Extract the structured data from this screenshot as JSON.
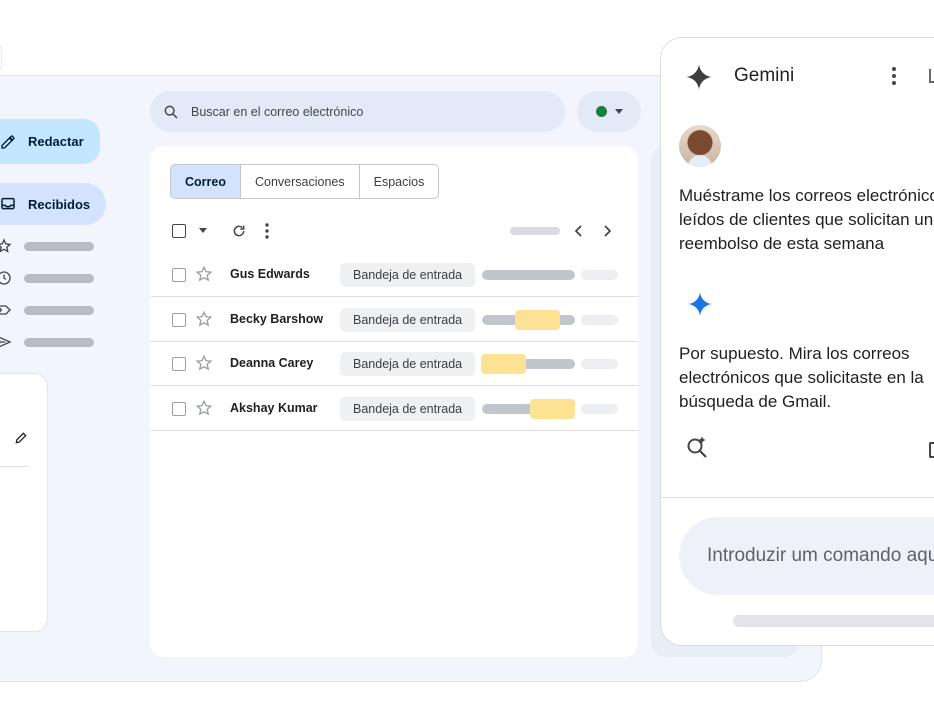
{
  "sidebar": {
    "compose_label": "Redactar",
    "inbox_label": "Recibidos",
    "icons": [
      "star-icon",
      "clock-icon",
      "label-icon",
      "send-icon"
    ]
  },
  "search": {
    "placeholder": "Buscar en el correo electrónico"
  },
  "status": {
    "color": "#188038"
  },
  "mail": {
    "tabs": [
      {
        "label": "Correo",
        "active": true
      },
      {
        "label": "Conversaciones",
        "active": false
      },
      {
        "label": "Espacios",
        "active": false
      }
    ],
    "rows": [
      {
        "sender": "Gus Edwards",
        "label": "Bandeja de entrada"
      },
      {
        "sender": "Becky Barshow",
        "label": "Bandeja de entrada"
      },
      {
        "sender": "Deanna Carey",
        "label": "Bandeja de entrada"
      },
      {
        "sender": "Akshay Kumar",
        "label": "Bandeja de entrada"
      }
    ]
  },
  "gemini": {
    "title": "Gemini",
    "prompt": "Muéstrame los correos electrónicos no\nleídos de clientes que solicitan un\nreembolso de esta semana",
    "answer": "Por supuesto. Mira los correos\nelectrónicos que solicitaste en la\nbúsqueda de Gmail.",
    "input_placeholder": "Introduzir um comando aqui"
  },
  "colors": {
    "accent": "#c2e7ff",
    "highlight": "#fde293",
    "gemini_blue": "#1a73e8"
  }
}
